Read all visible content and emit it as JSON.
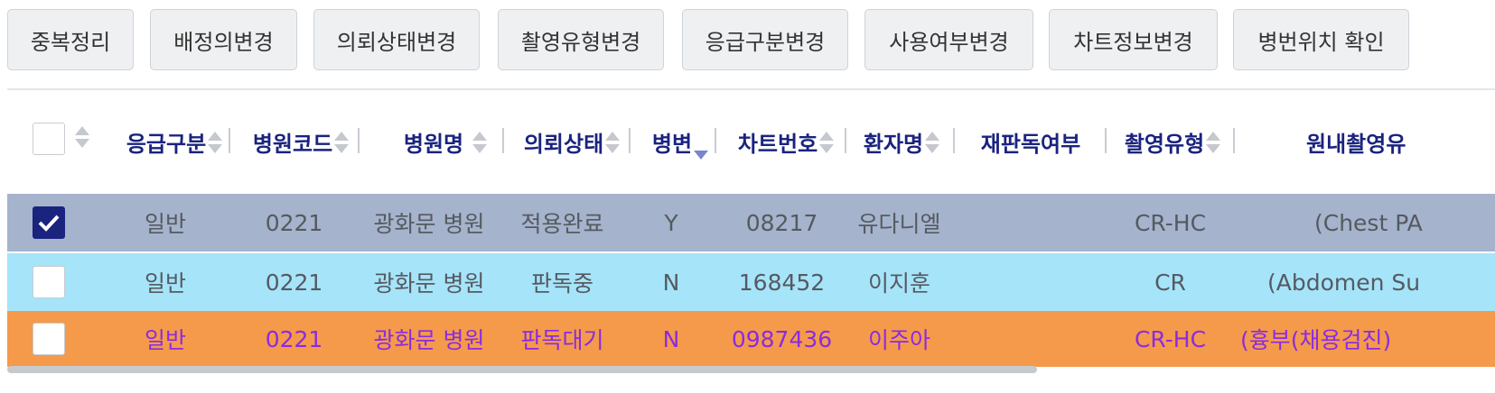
{
  "toolbar": {
    "buttons": [
      {
        "label": "중복정리"
      },
      {
        "label": "배정의변경"
      },
      {
        "label": "의뢰상태변경"
      },
      {
        "label": "촬영유형변경"
      },
      {
        "label": "응급구분변경"
      },
      {
        "label": "사용여부변경"
      },
      {
        "label": "차트정보변경"
      },
      {
        "label": "병번위치 확인"
      }
    ]
  },
  "table": {
    "columns": [
      {
        "label": "응급구분"
      },
      {
        "label": "병원코드"
      },
      {
        "label": "병원명"
      },
      {
        "label": "의뢰상태"
      },
      {
        "label": "병변"
      },
      {
        "label": "차트번호"
      },
      {
        "label": "환자명"
      },
      {
        "label": "재판독여부"
      },
      {
        "label": "촬영유형"
      },
      {
        "label": "원내촬영유"
      }
    ],
    "sort_active_column": "병변",
    "rows": [
      {
        "checked": true,
        "bg": "#a5b3cd",
        "color": "#555a60",
        "cells": [
          "일반",
          "0221",
          "광화문 병원",
          "적용완료",
          "Y",
          "08217",
          "유다니엘",
          "",
          "CR-HC",
          "(Chest PA"
        ]
      },
      {
        "checked": false,
        "bg": "#a6e4fa",
        "color": "#555a60",
        "cells": [
          "일반",
          "0221",
          "광화문 병원",
          "판독중",
          "N",
          "168452",
          "이지훈",
          "",
          "CR",
          "(Abdomen Su"
        ]
      },
      {
        "checked": false,
        "bg": "#f59a4a",
        "color": "#8a2be2",
        "cells": [
          "일반",
          "0221",
          "광화문 병원",
          "판독대기",
          "N",
          "0987436",
          "이주아",
          "",
          "CR-HC",
          "(흉부(채용검진)"
        ]
      }
    ]
  }
}
